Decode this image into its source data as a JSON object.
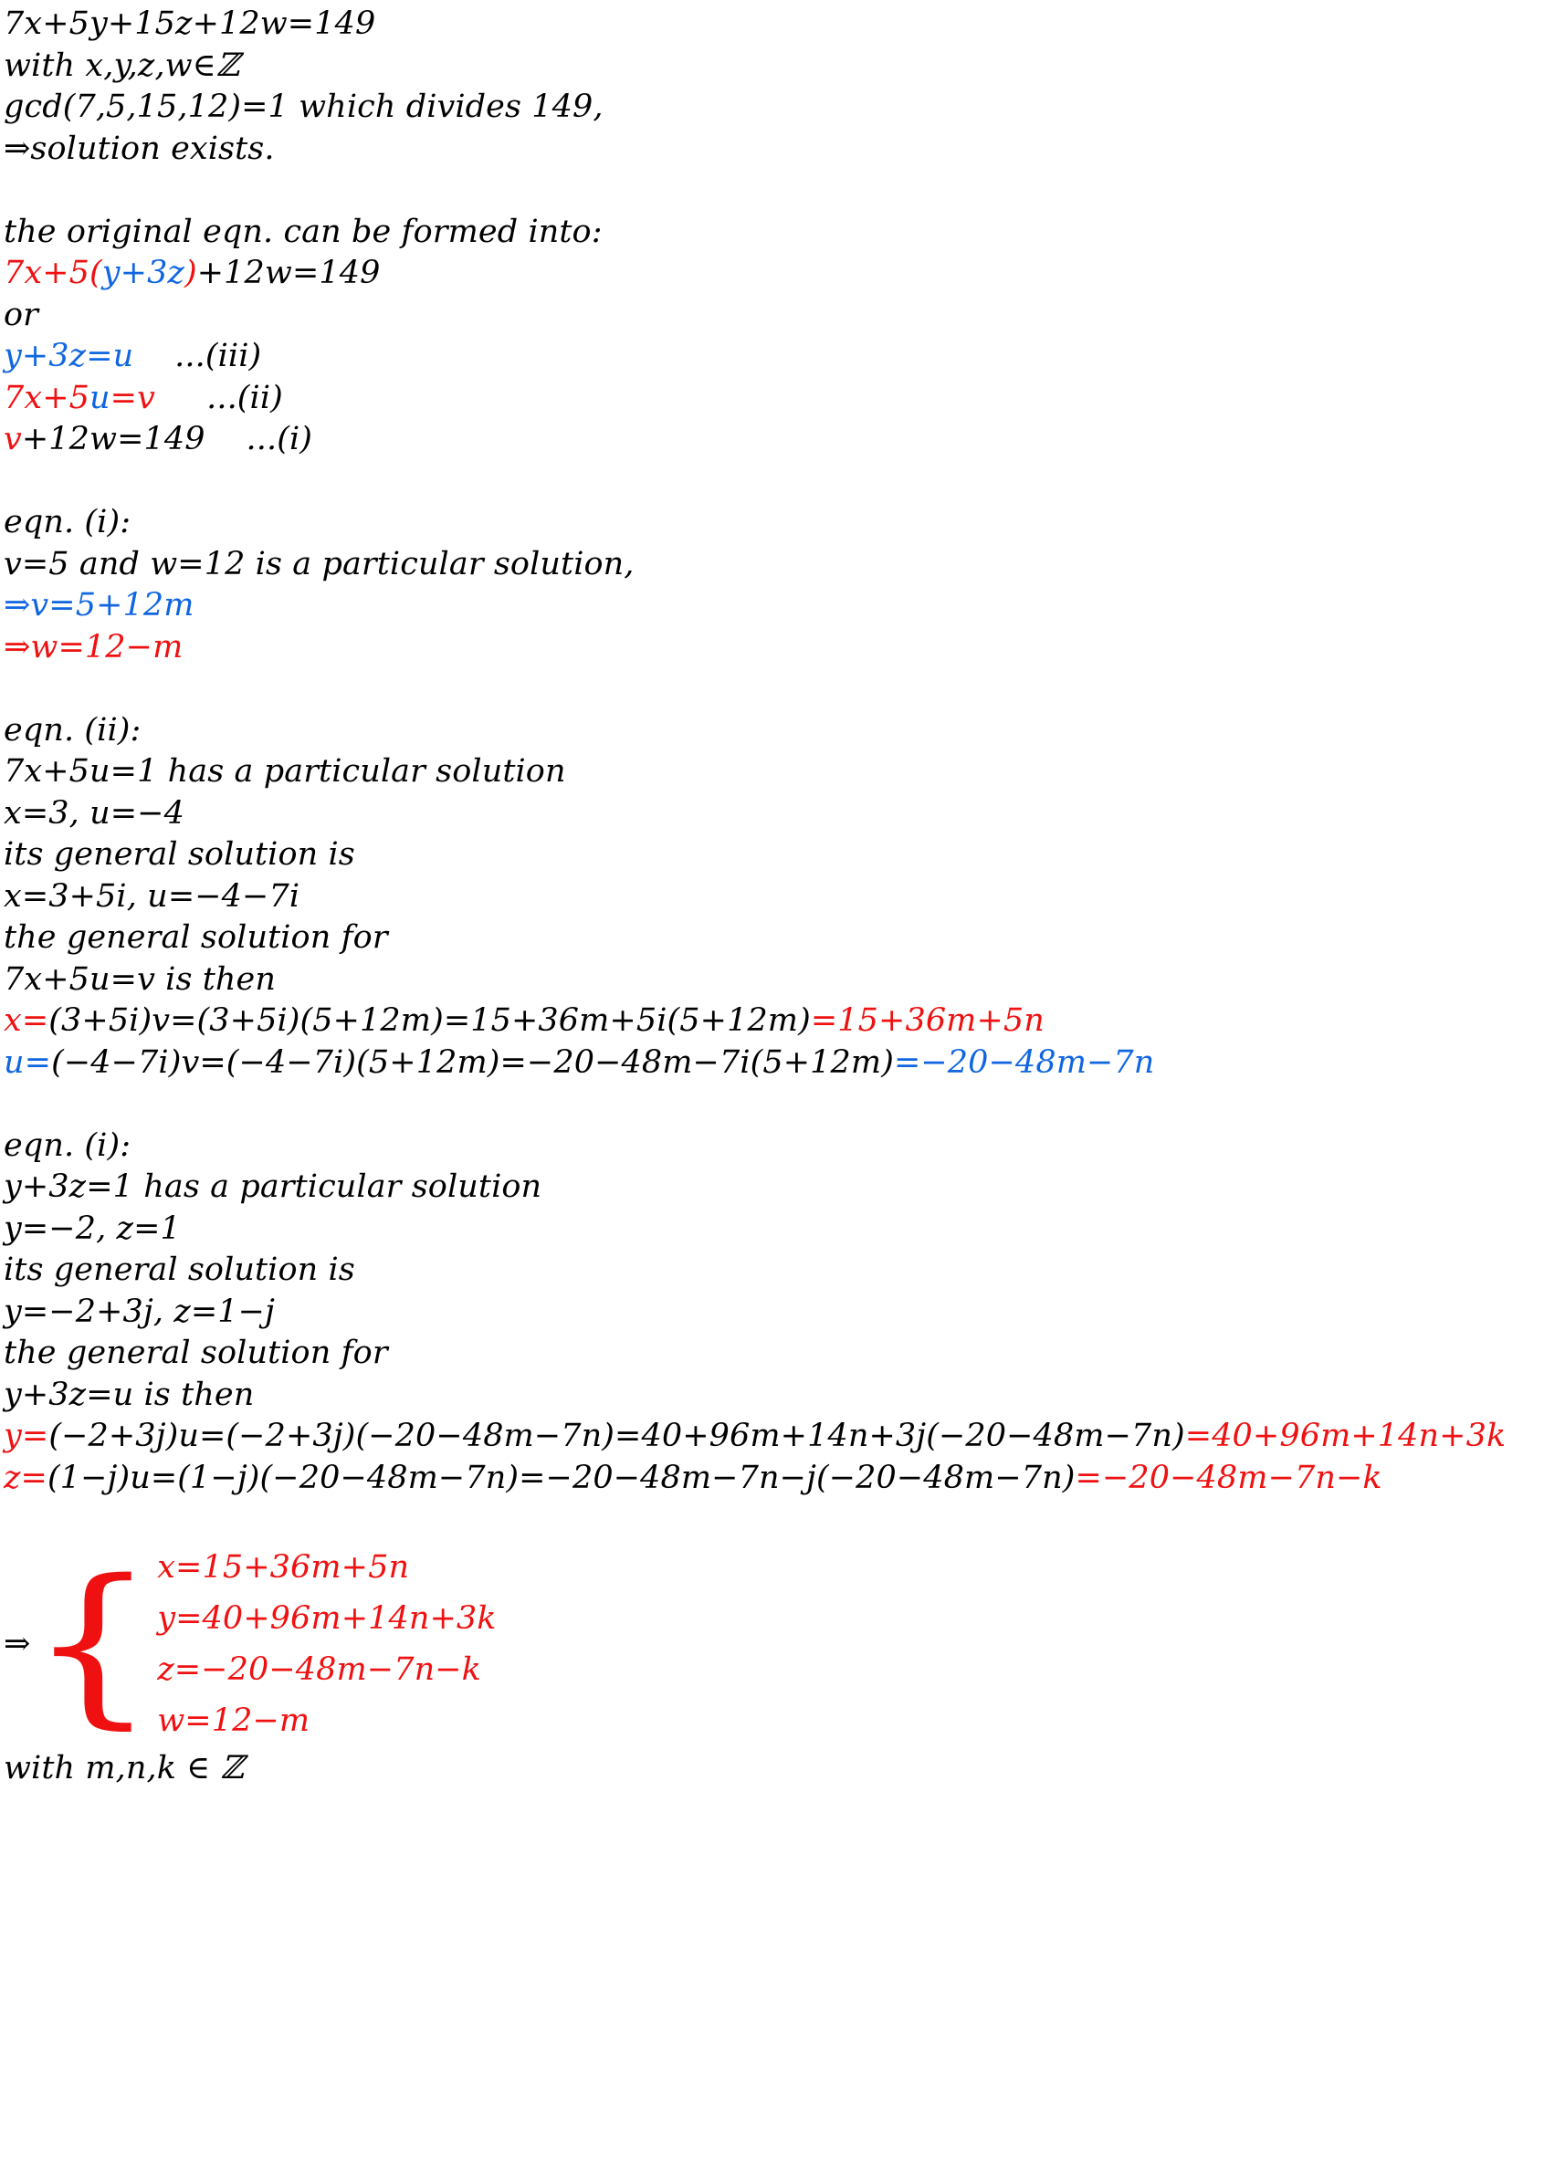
{
  "document": {
    "title": "Linear Diophantine equation solution",
    "colors": {
      "red": "#ef1111",
      "blue": "#1066e0",
      "black": "#000000",
      "background": "#ffffff"
    }
  },
  "lines": {
    "l01": "7x+5y+15z+12w=149",
    "l02": "with x,y,z,w∈ℤ",
    "l03": "gcd(7,5,15,12)=1 which divides 149,",
    "l04": "⇒solution exists.",
    "l06": "the original eqn. can be formed into:",
    "l07a": "7x+5(",
    "l07b": "y+3z",
    "l07c": ")",
    "l07d": "+12w=149",
    "l08": "or",
    "l09a": "y+3z=u",
    "l09b": "    ...(iii)",
    "l10a": "7x+5",
    "l10b": "u",
    "l10c": "=v",
    "l10d": "     ...(ii)",
    "l11a": "v",
    "l11b": "+12w=149    ...(i)",
    "l13": "eqn. (i):",
    "l14": "v=5 and w=12 is a particular solution,",
    "l15": "⇒v=5+12m",
    "l16": "⇒w=12−m",
    "l18": "eqn. (ii):",
    "l19": "7x+5u=1 has a particular solution",
    "l20": "x=3, u=−4",
    "l21": "its general solution is",
    "l22": "x=3+5i, u=−4−7i",
    "l23": "the general solution for",
    "l24": "7x+5u=v is then",
    "l25a": "x=",
    "l25b": "(3+5i)v=(3+5i)(5+12m)=15+36m+5i(5+12m)",
    "l25c": "=15+36m+5n",
    "l26a": "u=",
    "l26b": "(−4−7i)v=(−4−7i)(5+12m)=−20−48m−7i(5+12m)",
    "l26c": "=−20−48m−7n",
    "l28": "eqn. (i):",
    "l29": "y+3z=1 has a particular solution",
    "l30": "y=−2, z=1",
    "l31": "its general solution is",
    "l32": "y=−2+3j, z=1−j",
    "l33": "the general solution for",
    "l34": "y+3z=u is then",
    "l35a": "y=",
    "l35b": "(−2+3j)u=(−2+3j)(−20−48m−7n)=40+96m+14n+3j(−20−48m−7n)",
    "l35c": "=40+96m+14n+3k",
    "l36a": "z=",
    "l36b": "(1−j)u=(1−j)(−20−48m−7n)=−20−48m−7n−j(−20−48m−7n)",
    "l36c": "=−20−48m−7n−k",
    "l38_arrow": "⇒",
    "l38_brace": "{",
    "system": [
      "x=15+36m+5n",
      "y=40+96m+14n+3k",
      "z=−20−48m−7n−k",
      "w=12−m"
    ],
    "l43": "with m,n,k ∈ ℤ"
  }
}
